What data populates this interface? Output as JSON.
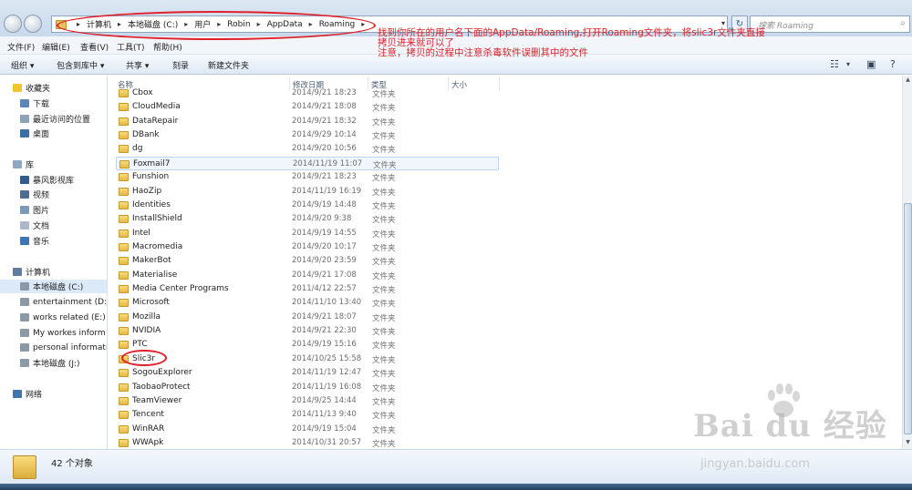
{
  "address": {
    "crumbs": [
      "计算机",
      "本地磁盘 (C:)",
      "用户",
      "Robin",
      "AppData",
      "Roaming"
    ],
    "search_placeholder": "搜索 Roaming"
  },
  "annotation": {
    "line1": "找到你所在的用户名下面的AppData/Roaming,打开Roaming文件夹，将slic3r文件夹直接",
    "line2": "拷贝进来就可以了",
    "line3": "注意，拷贝的过程中注意杀毒软件误删其中的文件",
    "color": "#d8242a"
  },
  "menu": [
    "文件(F)",
    "编辑(E)",
    "查看(V)",
    "工具(T)",
    "帮助(H)"
  ],
  "toolbar": {
    "organize": "组织 ▾",
    "include": "包含到库中 ▾",
    "share": "共享 ▾",
    "burn": "刻录",
    "new_folder": "新建文件夹"
  },
  "sidebar": {
    "items": [
      {
        "label": "收藏夹",
        "icon": "star-icon"
      },
      {
        "label": "下载",
        "icon": "download-icon"
      },
      {
        "label": "最近访问的位置",
        "icon": "recent-icon"
      },
      {
        "label": "桌面",
        "icon": "desktop-icon"
      },
      {
        "label": "库",
        "icon": "library-icon"
      },
      {
        "label": "暴风影视库",
        "icon": "video-library-icon"
      },
      {
        "label": "视频",
        "icon": "video-icon"
      },
      {
        "label": "图片",
        "icon": "picture-icon"
      },
      {
        "label": "文档",
        "icon": "document-icon"
      },
      {
        "label": "音乐",
        "icon": "music-icon"
      },
      {
        "label": "计算机",
        "icon": "computer-icon"
      },
      {
        "label": "本地磁盘 (C:)",
        "icon": "drive-icon"
      },
      {
        "label": "entertainment (D:)",
        "icon": "drive-icon"
      },
      {
        "label": "works related (E:)",
        "icon": "drive-icon"
      },
      {
        "label": "My workes inform",
        "icon": "drive-icon"
      },
      {
        "label": "personal informati",
        "icon": "drive-icon"
      },
      {
        "label": "本地磁盘 (J:)",
        "icon": "drive-icon"
      },
      {
        "label": "网络",
        "icon": "network-icon"
      }
    ]
  },
  "columns": {
    "name": "名称",
    "date": "修改日期",
    "type": "类型",
    "size": "大小"
  },
  "files": [
    {
      "name": "Cbox",
      "date": "2014/9/21 18:23",
      "type": "文件夹"
    },
    {
      "name": "CloudMedia",
      "date": "2014/9/21 18:08",
      "type": "文件夹"
    },
    {
      "name": "DataRepair",
      "date": "2014/9/21 18:32",
      "type": "文件夹"
    },
    {
      "name": "DBank",
      "date": "2014/9/29 10:14",
      "type": "文件夹"
    },
    {
      "name": "dg",
      "date": "2014/9/20 10:56",
      "type": "文件夹"
    },
    {
      "name": "Foxmail7",
      "date": "2014/11/19 11:07",
      "type": "文件夹"
    },
    {
      "name": "Funshion",
      "date": "2014/9/21 18:23",
      "type": "文件夹"
    },
    {
      "name": "HaoZip",
      "date": "2014/11/19 16:19",
      "type": "文件夹"
    },
    {
      "name": "Identities",
      "date": "2014/9/19 14:48",
      "type": "文件夹"
    },
    {
      "name": "InstallShield",
      "date": "2014/9/20 9:38",
      "type": "文件夹"
    },
    {
      "name": "Intel",
      "date": "2014/9/19 14:55",
      "type": "文件夹"
    },
    {
      "name": "Macromedia",
      "date": "2014/9/20 10:17",
      "type": "文件夹"
    },
    {
      "name": "MakerBot",
      "date": "2014/9/20 23:59",
      "type": "文件夹"
    },
    {
      "name": "Materialise",
      "date": "2014/9/21 17:08",
      "type": "文件夹"
    },
    {
      "name": "Media Center Programs",
      "date": "2011/4/12 22:57",
      "type": "文件夹"
    },
    {
      "name": "Microsoft",
      "date": "2014/11/10 13:40",
      "type": "文件夹"
    },
    {
      "name": "Mozilla",
      "date": "2014/9/21 18:07",
      "type": "文件夹"
    },
    {
      "name": "NVIDIA",
      "date": "2014/9/21 22:30",
      "type": "文件夹"
    },
    {
      "name": "PTC",
      "date": "2014/9/19 15:16",
      "type": "文件夹"
    },
    {
      "name": "Slic3r",
      "date": "2014/10/25 15:58",
      "type": "文件夹"
    },
    {
      "name": "SogouExplorer",
      "date": "2014/11/19 12:47",
      "type": "文件夹"
    },
    {
      "name": "TaobaoProtect",
      "date": "2014/11/19 16:08",
      "type": "文件夹"
    },
    {
      "name": "TeamViewer",
      "date": "2014/9/25 14:44",
      "type": "文件夹"
    },
    {
      "name": "Tencent",
      "date": "2014/11/13 9:40",
      "type": "文件夹"
    },
    {
      "name": "WinRAR",
      "date": "2014/9/19 15:04",
      "type": "文件夹"
    },
    {
      "name": "WWApk",
      "date": "2014/10/31 20:57",
      "type": "文件夹"
    }
  ],
  "status": {
    "count": "42 个对象"
  },
  "watermark": {
    "logo": "Bai du 经验",
    "url": "jingyan.baidu.com"
  }
}
